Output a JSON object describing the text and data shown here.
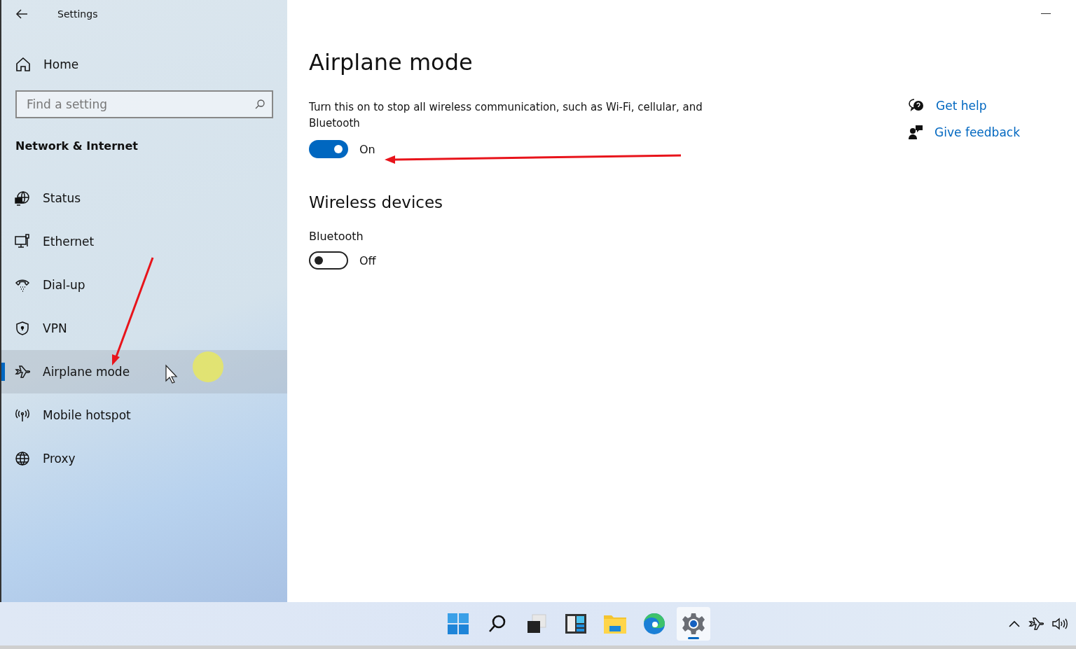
{
  "window": {
    "title": "Settings"
  },
  "sidebar": {
    "home": "Home",
    "search": {
      "placeholder": "Find a setting"
    },
    "section": "Network & Internet",
    "items": [
      {
        "label": "Status",
        "kind": "status",
        "selected": false
      },
      {
        "label": "Ethernet",
        "kind": "ethernet",
        "selected": false
      },
      {
        "label": "Dial-up",
        "kind": "dialup",
        "selected": false
      },
      {
        "label": "VPN",
        "kind": "vpn",
        "selected": false
      },
      {
        "label": "Airplane mode",
        "kind": "airplane",
        "selected": true
      },
      {
        "label": "Mobile hotspot",
        "kind": "hotspot",
        "selected": false
      },
      {
        "label": "Proxy",
        "kind": "proxy",
        "selected": false
      }
    ]
  },
  "main": {
    "title": "Airplane mode",
    "description": "Turn this on to stop all wireless communication, such as Wi-Fi, cellular, and Bluetooth",
    "toggle": {
      "on": true,
      "label": "On"
    },
    "section": "Wireless devices",
    "devices": [
      {
        "name": "Bluetooth",
        "on": false,
        "label": "Off"
      }
    ],
    "links": [
      {
        "label": "Get help",
        "kind": "help"
      },
      {
        "label": "Give feedback",
        "kind": "feedback"
      }
    ]
  },
  "taskbar": {
    "apps": [
      {
        "kind": "start",
        "selected": false
      },
      {
        "kind": "search",
        "selected": false
      },
      {
        "kind": "taskview",
        "selected": false
      },
      {
        "kind": "widgets",
        "selected": false
      },
      {
        "kind": "explorer",
        "selected": false
      },
      {
        "kind": "edge",
        "selected": false
      },
      {
        "kind": "settings",
        "selected": true
      }
    ],
    "tray": [
      {
        "kind": "chevron"
      },
      {
        "kind": "airplane"
      },
      {
        "kind": "volume"
      }
    ]
  }
}
